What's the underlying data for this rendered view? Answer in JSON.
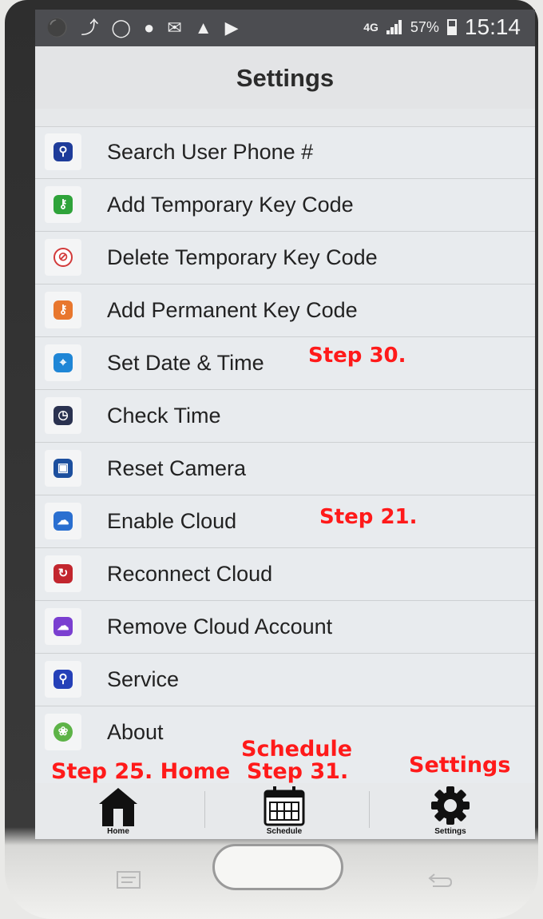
{
  "status_bar": {
    "left_icons": [
      "wechat-icon",
      "missed-call-icon",
      "voicemail-icon",
      "app-notification-icon",
      "mail-icon",
      "warning-icon",
      "play-icon"
    ],
    "network": "4G",
    "battery": "57%",
    "battery_level": 0.57,
    "time": "15:14"
  },
  "header": {
    "title": "Settings"
  },
  "menu": {
    "items": [
      {
        "label": "Search User Phone #",
        "icon": "search-icon",
        "color": "#1e3c9a"
      },
      {
        "label": "Add Temporary Key Code",
        "icon": "key-icon",
        "color": "#2fa33a"
      },
      {
        "label": "Delete Temporary Key Code",
        "icon": "delete-key-icon",
        "color": "#d23a3a"
      },
      {
        "label": "Add Permanent Key Code",
        "icon": "permanent-key-icon",
        "color": "#e8772e"
      },
      {
        "label": "Set Date & Time",
        "icon": "compass-clock-icon",
        "color": "#1f86d6"
      },
      {
        "label": "Check Time",
        "icon": "clock-icon",
        "color": "#2a3250"
      },
      {
        "label": "Reset Camera",
        "icon": "camera-icon",
        "color": "#1c4f9e"
      },
      {
        "label": "Enable Cloud",
        "icon": "cloud-icon",
        "color": "#2a6fd0"
      },
      {
        "label": "Reconnect Cloud",
        "icon": "reconnect-icon",
        "color": "#c2262e"
      },
      {
        "label": "Remove Cloud Account",
        "icon": "remove-cloud-icon",
        "color": "#7a3fd0"
      },
      {
        "label": "Service",
        "icon": "service-icon",
        "color": "#2540b8"
      },
      {
        "label": "About",
        "icon": "leaf-icon",
        "color": "#5db347"
      }
    ]
  },
  "annotations": {
    "step30": "Step 30.",
    "step21": "Step 21.",
    "step25_home": "Step 25. Home",
    "schedule": "Schedule",
    "step31": "Step 31.",
    "settings": "Settings"
  },
  "tabbar": {
    "home": "Home",
    "schedule": "Schedule",
    "settings": "Settings"
  }
}
